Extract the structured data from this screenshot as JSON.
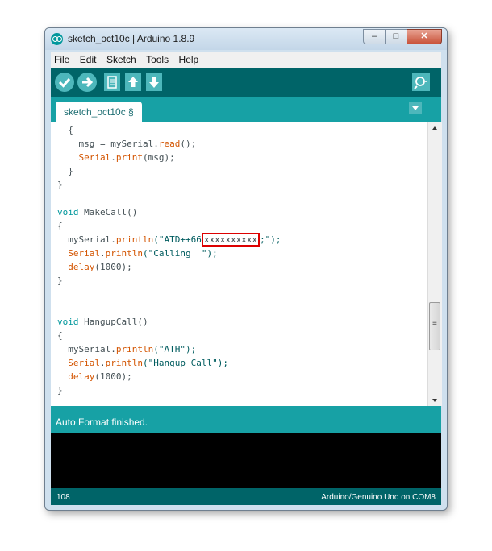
{
  "window": {
    "title": "sketch_oct10c | Arduino 1.8.9",
    "controls": [
      "minimize",
      "maximize",
      "close"
    ]
  },
  "menubar": {
    "items": [
      "File",
      "Edit",
      "Sketch",
      "Tools",
      "Help"
    ]
  },
  "toolbar": {
    "buttons": [
      "verify-icon",
      "upload-icon",
      "new-icon",
      "open-icon",
      "save-icon",
      "serial-monitor-icon"
    ]
  },
  "tabs": {
    "active": "sketch_oct10c §"
  },
  "editor": {
    "lines": [
      {
        "parts": [
          {
            "t": "  {",
            "c": ""
          }
        ]
      },
      {
        "parts": [
          {
            "t": "    msg = mySerial.",
            "c": ""
          },
          {
            "t": "read",
            "c": "fn"
          },
          {
            "t": "();",
            "c": ""
          }
        ]
      },
      {
        "parts": [
          {
            "t": "    ",
            "c": ""
          },
          {
            "t": "Serial",
            "c": "fn"
          },
          {
            "t": ".",
            "c": ""
          },
          {
            "t": "print",
            "c": "fn"
          },
          {
            "t": "(msg);",
            "c": ""
          }
        ]
      },
      {
        "parts": [
          {
            "t": "  }",
            "c": ""
          }
        ]
      },
      {
        "parts": [
          {
            "t": "}",
            "c": ""
          }
        ]
      },
      {
        "parts": [
          {
            "t": "",
            "c": ""
          }
        ]
      },
      {
        "parts": [
          {
            "t": "void",
            "c": "kw"
          },
          {
            "t": " MakeCall()",
            "c": ""
          }
        ]
      },
      {
        "parts": [
          {
            "t": "{",
            "c": ""
          }
        ]
      },
      {
        "parts": [
          {
            "t": "  mySerial.",
            "c": ""
          },
          {
            "t": "println",
            "c": "fn"
          },
          {
            "t": "(\"ATD++66",
            "c": "st"
          },
          {
            "t": "xxxxxxxxxx",
            "c": "redact"
          },
          {
            "t": ";\");",
            "c": "st"
          }
        ]
      },
      {
        "parts": [
          {
            "t": "  ",
            "c": ""
          },
          {
            "t": "Serial",
            "c": "fn"
          },
          {
            "t": ".",
            "c": ""
          },
          {
            "t": "println",
            "c": "fn"
          },
          {
            "t": "(\"Calling  \");",
            "c": "st"
          }
        ]
      },
      {
        "parts": [
          {
            "t": "  ",
            "c": ""
          },
          {
            "t": "delay",
            "c": "fn"
          },
          {
            "t": "(1000);",
            "c": ""
          }
        ]
      },
      {
        "parts": [
          {
            "t": "}",
            "c": ""
          }
        ]
      },
      {
        "parts": [
          {
            "t": "",
            "c": ""
          }
        ]
      },
      {
        "parts": [
          {
            "t": "",
            "c": ""
          }
        ]
      },
      {
        "parts": [
          {
            "t": "void",
            "c": "kw"
          },
          {
            "t": " HangupCall()",
            "c": ""
          }
        ]
      },
      {
        "parts": [
          {
            "t": "{",
            "c": ""
          }
        ]
      },
      {
        "parts": [
          {
            "t": "  mySerial.",
            "c": ""
          },
          {
            "t": "println",
            "c": "fn"
          },
          {
            "t": "(\"ATH\");",
            "c": "st"
          }
        ]
      },
      {
        "parts": [
          {
            "t": "  ",
            "c": ""
          },
          {
            "t": "Serial",
            "c": "fn"
          },
          {
            "t": ".",
            "c": ""
          },
          {
            "t": "println",
            "c": "fn"
          },
          {
            "t": "(\"Hangup Call\");",
            "c": "st"
          }
        ]
      },
      {
        "parts": [
          {
            "t": "  ",
            "c": ""
          },
          {
            "t": "delay",
            "c": "fn"
          },
          {
            "t": "(1000);",
            "c": ""
          }
        ]
      },
      {
        "parts": [
          {
            "t": "}",
            "c": ""
          }
        ]
      }
    ]
  },
  "status": {
    "message": "Auto Format finished."
  },
  "footer": {
    "line_number": "108",
    "board": "Arduino/Genuino Uno on COM8"
  },
  "colors": {
    "toolbar": "#006468",
    "accent": "#17a1a5",
    "button": "#4db7bb",
    "keyword": "#00979c",
    "function": "#d35400",
    "redaction_box": "#dd0000"
  }
}
